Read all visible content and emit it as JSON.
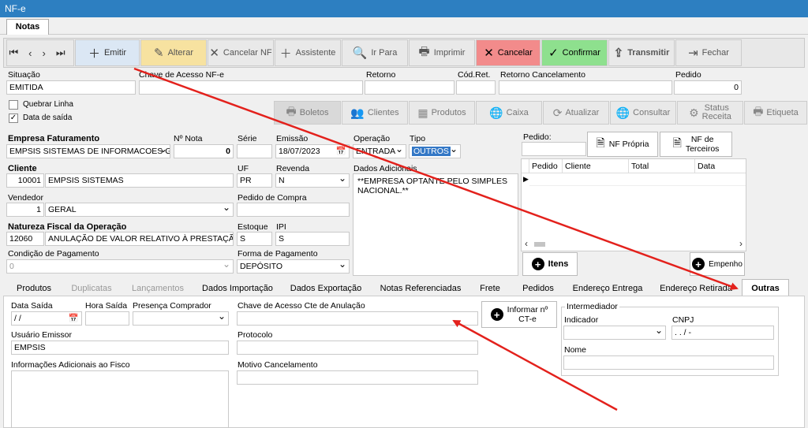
{
  "window": {
    "title": "NF-e"
  },
  "main_tab": "Notas",
  "toolbar": {
    "emitir": "Emitir",
    "alterar": "Alterar",
    "cancelar_nf": "Cancelar NF",
    "assistente": "Assistente",
    "ir_para": "Ir Para",
    "imprimir": "Imprimir",
    "cancelar": "Cancelar",
    "confirmar": "Confirmar",
    "transmitir": "Transmitir",
    "fechar": "Fechar",
    "colors": {
      "cancelar_bg": "#f28b8b",
      "confirmar_bg": "#8ee08e",
      "alterar_bg": "#f7e2a0",
      "emitir_bg": "#dbe7f4"
    }
  },
  "row1": {
    "situacao_label": "Situação",
    "situacao_value": "EMITIDA",
    "chave_label": "Chave de Acesso NF-e",
    "chave_value": "",
    "retorno_label": "Retorno",
    "retorno_value": "",
    "codret_label": "Cód.Ret.",
    "codret_value": "",
    "retorno_cancel_label": "Retorno Cancelamento",
    "retorno_cancel_value": "",
    "pedido_label": "Pedido",
    "pedido_value": "0"
  },
  "options": {
    "quebrar_linha": "Quebrar Linha",
    "data_saida": "Data de saída",
    "data_saida_checked": "✓"
  },
  "toolbar2": {
    "boletos": "Boletos",
    "clientes": "Clientes",
    "produtos": "Produtos",
    "caixa": "Caixa",
    "atualizar": "Atualizar",
    "consultar": "Consultar",
    "status_receita_1": "Status",
    "status_receita_2": "Receita",
    "etiqueta": "Etiqueta"
  },
  "form": {
    "empresa_label": "Empresa Faturamento",
    "empresa_value": "EMPSIS SISTEMAS DE INFORMACOES GEI",
    "nnota_label": "Nº Nota",
    "nnota_value": "0",
    "serie_label": "Série",
    "serie_value": "",
    "emissao_label": "Emissão",
    "emissao_value": "18/07/2023",
    "operacao_label": "Operação",
    "operacao_value": "ENTRADA",
    "tipo_label": "Tipo",
    "tipo_value": "OUTROS",
    "cliente_label": "Cliente",
    "cliente_code": "10001",
    "cliente_name": "EMPSIS SISTEMAS",
    "uf_label": "UF",
    "uf_value": "PR",
    "revenda_label": "Revenda",
    "revenda_value": "N",
    "dados_adicionais_label": "Dados Adicionais",
    "dados_adicionais_value": "**EMPRESA OPTANTE PELO SIMPLES NACIONAL.**",
    "vendedor_label": "Vendedor",
    "vendedor_code": "1",
    "vendedor_name": "GERAL",
    "pedido_compra_label": "Pedido de Compra",
    "pedido_compra_value": "",
    "natureza_label": "Natureza Fiscal da Operação",
    "natureza_code": "12060",
    "natureza_value": "ANULAÇÃO DE VALOR RELATIVO À PRESTAÇÃO D",
    "estoque_label": "Estoque",
    "estoque_value": "S",
    "ipi_label": "IPI",
    "ipi_value": "S",
    "cond_pag_label": "Condição de Pagamento",
    "cond_pag_value": "0",
    "forma_pag_label": "Forma de Pagamento",
    "forma_pag_value": "DEPÓSITO"
  },
  "pedido_panel": {
    "pedido_label": "Pedido:",
    "nf_propria": "NF Própria",
    "nf_terceiros_1": "NF de",
    "nf_terceiros_2": "Terceiros",
    "columns": [
      "Pedido",
      "Cliente",
      "Total",
      "Data"
    ],
    "itens": "Itens",
    "empenho": "Empenho"
  },
  "subtabs": [
    "Produtos",
    "Duplicatas",
    "Lançamentos",
    "Dados Importação",
    "Dados Exportação",
    "Notas Referenciadas",
    "Frete",
    "Pedidos",
    "Endereço Entrega",
    "Endereço Retirada",
    "Outras"
  ],
  "outras": {
    "data_saida_label": "Data Saída",
    "data_saida_value": " / /",
    "hora_saida_label": "Hora Saída",
    "hora_saida_value": "",
    "presenca_label": "Presença Comprador",
    "presenca_value": "",
    "chave_cte_label": "Chave de Acesso Cte de Anulação",
    "chave_cte_value": "",
    "informar_cte_1": "Informar nº",
    "informar_cte_2": "CT-e",
    "usuario_label": "Usuário Emissor",
    "usuario_value": "EMPSIS",
    "protocolo_label": "Protocolo",
    "protocolo_value": "",
    "info_fisco_label": "Informações Adicionais ao Fisco",
    "info_fisco_value": "",
    "motivo_label": "Motivo Cancelamento",
    "motivo_value": "",
    "intermediador_label": "Intermediador",
    "indicador_label": "Indicador",
    "indicador_value": "",
    "cnpj_label": "CNPJ",
    "cnpj_value": " .  .  /  -",
    "nome_label": "Nome",
    "nome_value": ""
  },
  "annotation": {
    "arrow_color": "#e3211c"
  }
}
